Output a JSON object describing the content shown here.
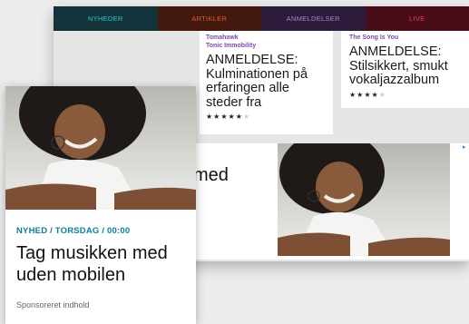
{
  "nav": {
    "items": [
      {
        "label": "NYHEDER"
      },
      {
        "label": "ARTIKLER"
      },
      {
        "label": "ANMELDELSER"
      },
      {
        "label": "LIVE"
      }
    ]
  },
  "reviews": [
    {
      "artist": "Tomahawk",
      "album": "Tonic Immobility",
      "headline": "ANMELDELSE: Kulminationen på erfaringen alle steder fra",
      "rating": 5,
      "max_rating": 6
    },
    {
      "artist": "",
      "album": "The Song Is You",
      "headline": "ANMELDELSE: Stilsikkert, smukt vokaljazzalbum",
      "rating": 4,
      "max_rating": 5
    }
  ],
  "ad": {
    "headline_fragment": "med",
    "choices_icon": "adchoices-icon",
    "image_alt_icon": "woman-with-earbuds-photo"
  },
  "card": {
    "meta": "NYHED / TORSDAG / 00:00",
    "title": "Tag musikken med uden mobilen",
    "sponsored": "Sponsoreret indhold"
  },
  "colors": {
    "nav_nyheder": "#14323a",
    "nav_artikler": "#43190d",
    "nav_anmeldelser": "#2c1b3b",
    "nav_live": "#480d18",
    "accent_teal": "#0a7f99",
    "review_purple": "#7a4aa8"
  }
}
